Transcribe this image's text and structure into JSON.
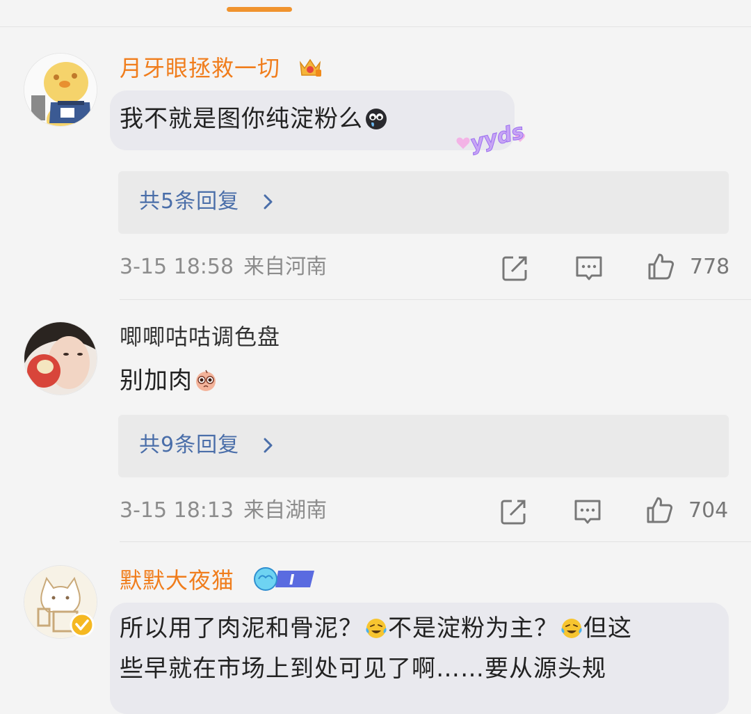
{
  "comments": [
    {
      "username": "月牙眼拯救一切",
      "text": "我不就是图你纯淀粉么",
      "text_emoji": "crying-face-emoji",
      "sticker": "yyds",
      "reply_link": "共5条回复",
      "time": "3-15 18:58",
      "location": "来自河南",
      "likes": "778",
      "accent_color": "#f07d1c"
    },
    {
      "username": "唧唧咕咕调色盘",
      "text": "别加肉",
      "text_emoji": "staring-face-emoji",
      "reply_link": "共9条回复",
      "time": "3-15 18:13",
      "location": "来自湖南",
      "likes": "704"
    },
    {
      "username": "默默大夜猫",
      "badge_text": "I",
      "text_lines": [
        "所以用了肉泥和骨泥？",
        "不是淀粉为主？",
        "但这",
        "些早就在市场上到处可见了啊……要从源头规"
      ],
      "text_emoji": "laughing-crying-emoji",
      "accent_color": "#f07d1c"
    }
  ],
  "icons": {
    "share": "share-icon",
    "comment": "comment-icon",
    "like": "thumbs-up-icon",
    "chevron": "chevron-right-icon"
  },
  "colors": {
    "link": "#4a6ea9",
    "meta": "#8c8c8c",
    "background": "#f4f4f4"
  }
}
